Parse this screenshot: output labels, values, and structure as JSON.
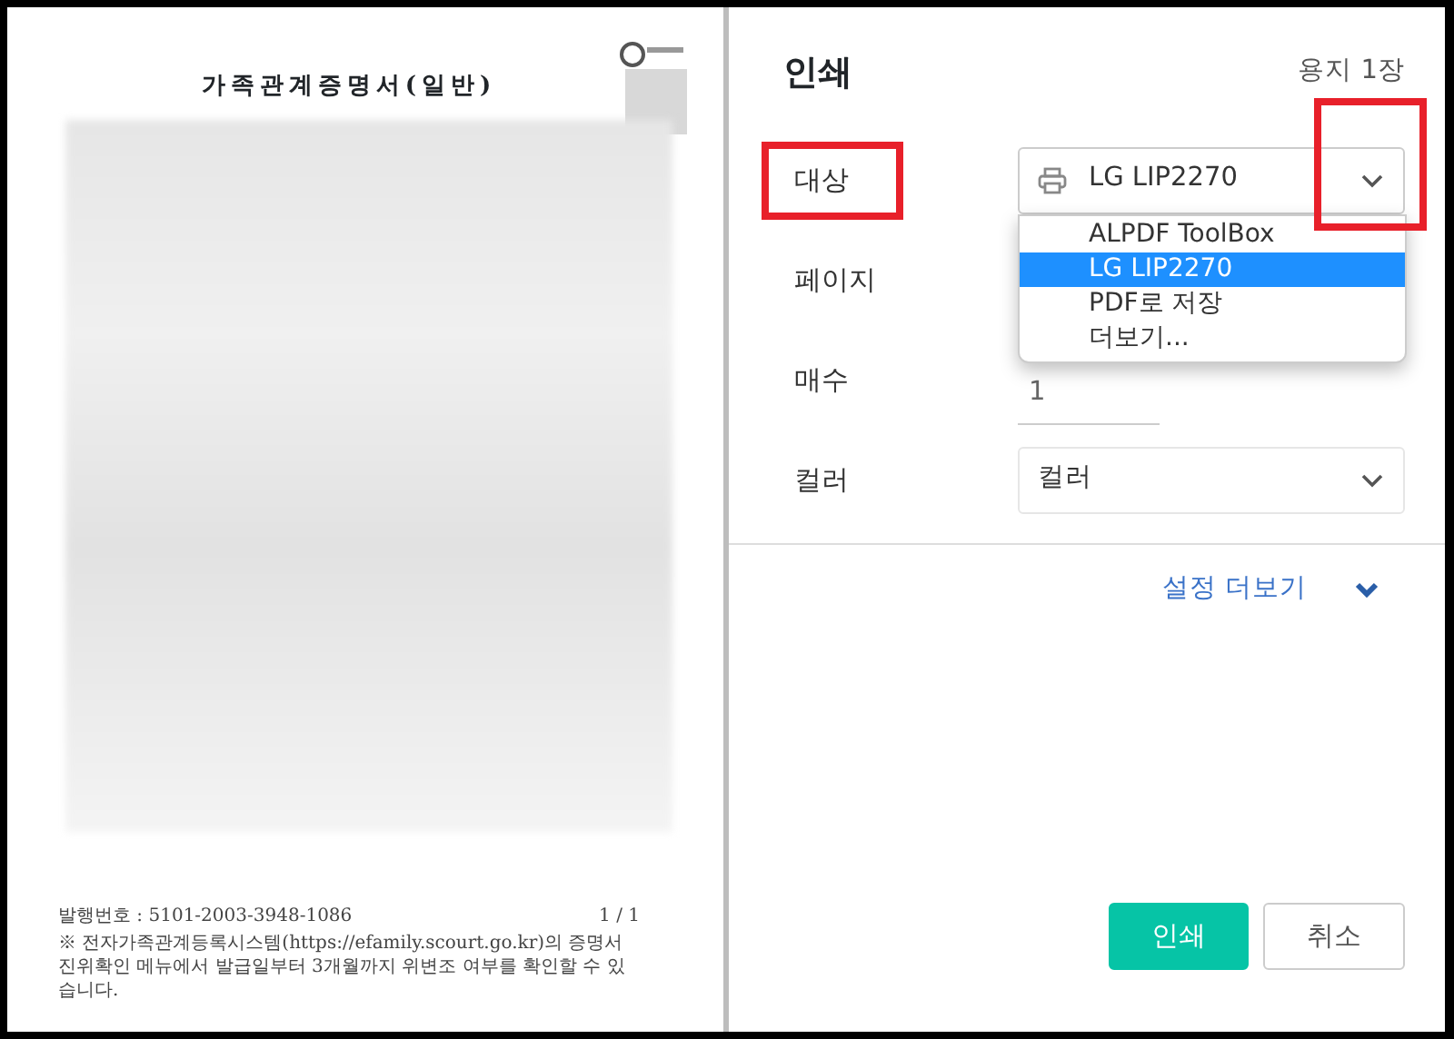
{
  "preview": {
    "document_title": "가족관계증명서(일반)",
    "issue_number": "발행번호 : 5101-2003-3948-1086",
    "page_number": "1 / 1",
    "notice": "※ 전자가족관계등록시스템(https://efamily.scourt.go.kr)의 증명서 진위확인 메뉴에서 발급일부터 3개월까지 위변조 여부를 확인할 수 있습니다."
  },
  "dialog": {
    "title": "인쇄",
    "sheet_count": "용지 1장",
    "fields": [
      {
        "kind": "printer-select",
        "label": "대상",
        "value": "LG LIP2270",
        "label_highlighted": true,
        "arrow_highlighted": true,
        "expanded": true,
        "options": [
          {
            "label": "ALPDF ToolBox",
            "selected": false
          },
          {
            "label": "LG LIP2270",
            "selected": true
          },
          {
            "label": "PDF로 저장",
            "selected": false
          },
          {
            "label": "더보기...",
            "selected": false
          }
        ]
      },
      {
        "kind": "covered",
        "label": "페이지"
      },
      {
        "kind": "number",
        "label": "매수",
        "value": "1"
      },
      {
        "kind": "select",
        "label": "컬러",
        "value": "컬러"
      }
    ],
    "more_settings": {
      "label": "설정 더보기",
      "expanded": false
    },
    "buttons": [
      {
        "kind": "primary",
        "label": "인쇄"
      },
      {
        "kind": "secondary",
        "label": "취소"
      }
    ]
  }
}
